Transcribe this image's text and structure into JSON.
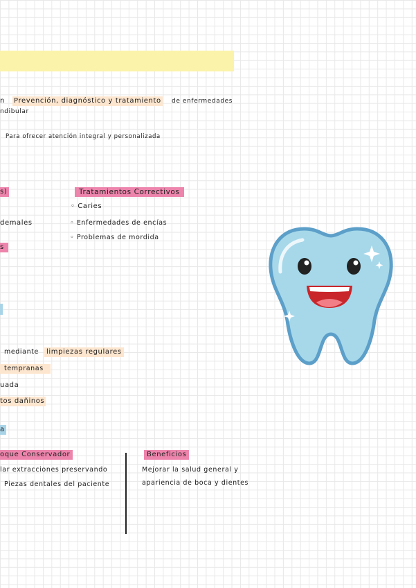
{
  "intro": {
    "line1_pre": "n",
    "line1_highlight": "Prevención, diagnóstico y tratamiento",
    "line1_post": "de enfermedades",
    "line2": "ndibular",
    "line3": "Para ofrecer atención integral y personalizada"
  },
  "left_col": {
    "heading_fragment": "s)",
    "item_fragment": "demales",
    "heading2_fragment": "s"
  },
  "correctivos": {
    "title": "Tratamientos Correctivos",
    "items": [
      "Caries",
      "Enfermedades de encías",
      "Problemas de mordida"
    ]
  },
  "prevention": {
    "line1_pre": "mediante",
    "line1_highlight": "limpiezas regulares",
    "line2": "tempranas",
    "line3": "uada",
    "line4": "tos dañinos",
    "label_fragment": "a"
  },
  "conservador": {
    "title": "oque Conservador",
    "line1": "lar extracciones preservando",
    "line2": "Piezas dentales del paciente"
  },
  "beneficios": {
    "title": "Beneficios",
    "line1": "Mejorar la salud general y",
    "line2": "apariencia de boca y dientes"
  },
  "colors": {
    "peach": "#fde6cf",
    "pink": "#ec84ab",
    "blue": "#a9d4e8",
    "yellow": "#fbf3a9",
    "tooth": "#a6d8ea"
  }
}
